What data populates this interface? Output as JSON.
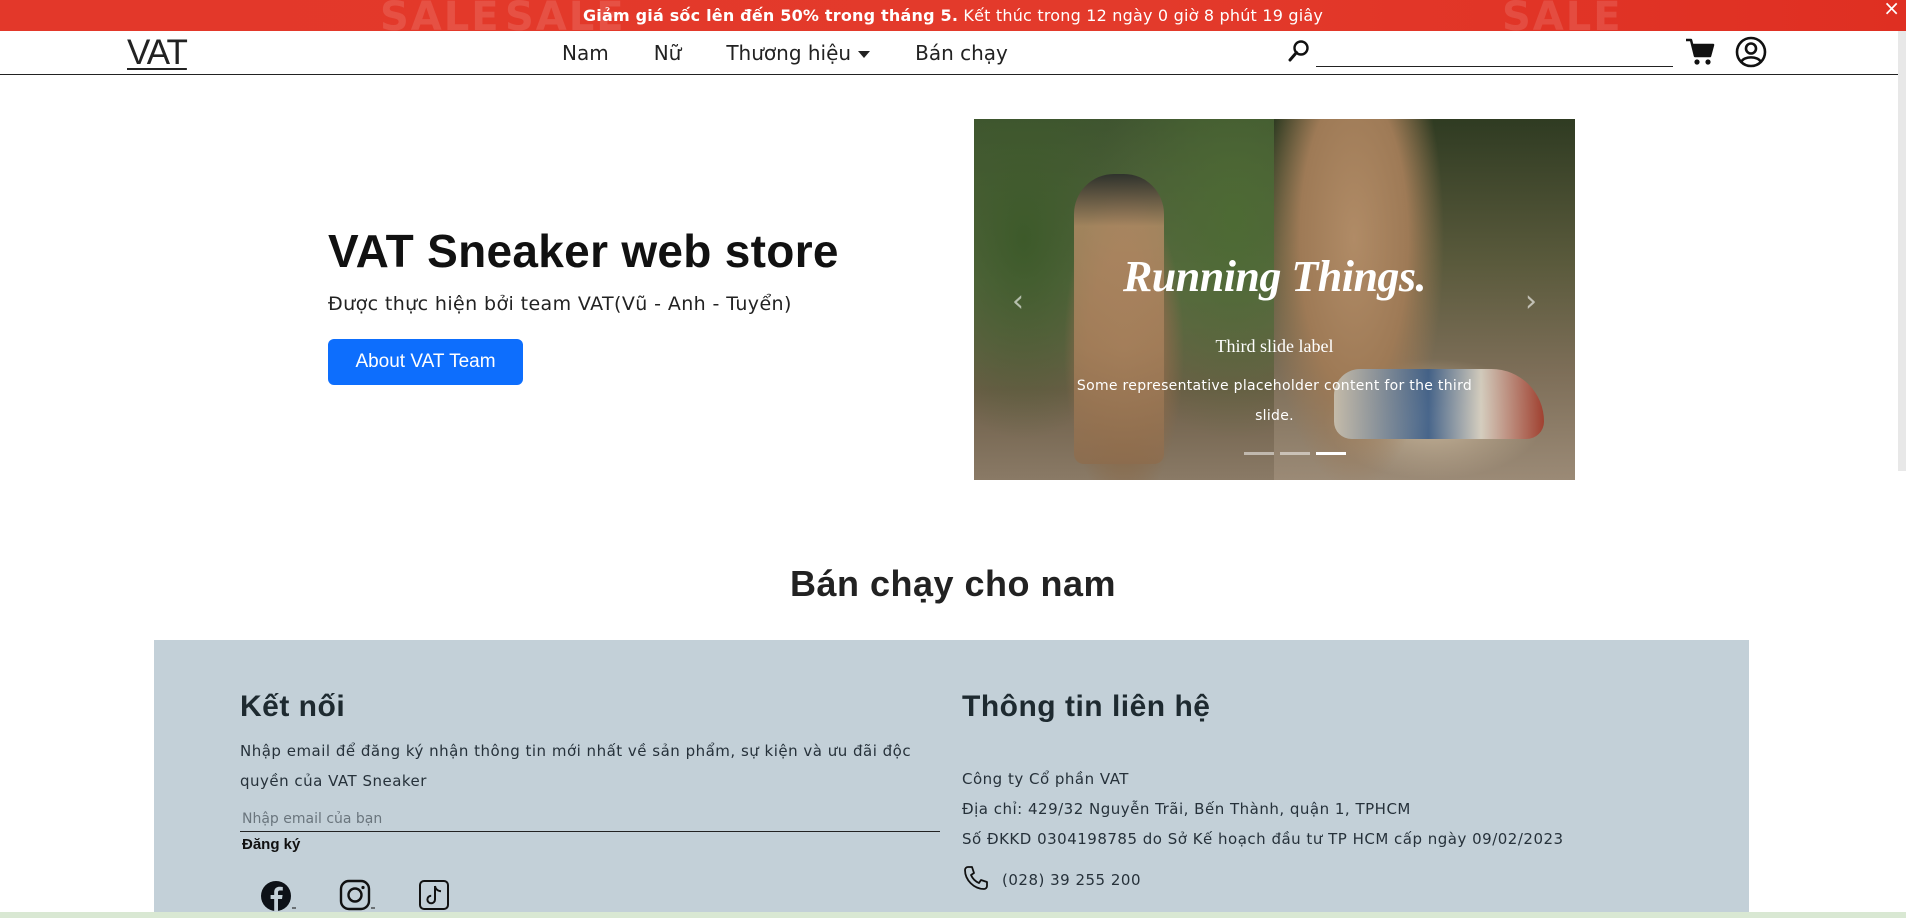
{
  "promo": {
    "ghost": "SALE",
    "bold": "Giảm giá sốc lên đến 50% trong tháng 5.",
    "rest": " Kết thúc trong 12 ngày 0 giờ 8 phút 19 giây",
    "close": "×"
  },
  "navbar": {
    "logo": "VAT",
    "links": [
      "Nam",
      "Nữ",
      "Thương hiệu",
      "Bán chạy"
    ],
    "search_placeholder": ""
  },
  "hero": {
    "title": "VAT Sneaker web store",
    "subtitle": "Được thực hiện bởi team VAT(Vũ - Anh - Tuyển)",
    "button": "About VAT Team"
  },
  "carousel": {
    "headline": "Running Things.",
    "caption_title": "Third slide label",
    "caption_text": "Some representative placeholder content for the third slide.",
    "prev": "‹",
    "next": "›",
    "active_index": 2,
    "slide_count": 3
  },
  "section": {
    "title": "Bán chạy cho nam"
  },
  "footer": {
    "connect": {
      "heading": "Kết nối",
      "text": "Nhập email để đăng ký nhận thông tin mới nhất về sản phẩm, sự kiện và ưu đãi độc quyền của VAT Sneaker",
      "email_placeholder": "Nhập email của bạn",
      "subscribe": "Đăng ký"
    },
    "contact": {
      "heading": "Thông tin liên hệ",
      "company": "Công ty Cổ phần VAT",
      "address": "Địa chỉ: 429/32 Nguyễn Trãi, Bến Thành, quận 1, TPHCM",
      "license": "Số ĐKKD 0304198785 do Sở Kế hoạch đầu tư TP HCM cấp ngày 09/02/2023",
      "phone": "(028) 39 255 200"
    }
  }
}
